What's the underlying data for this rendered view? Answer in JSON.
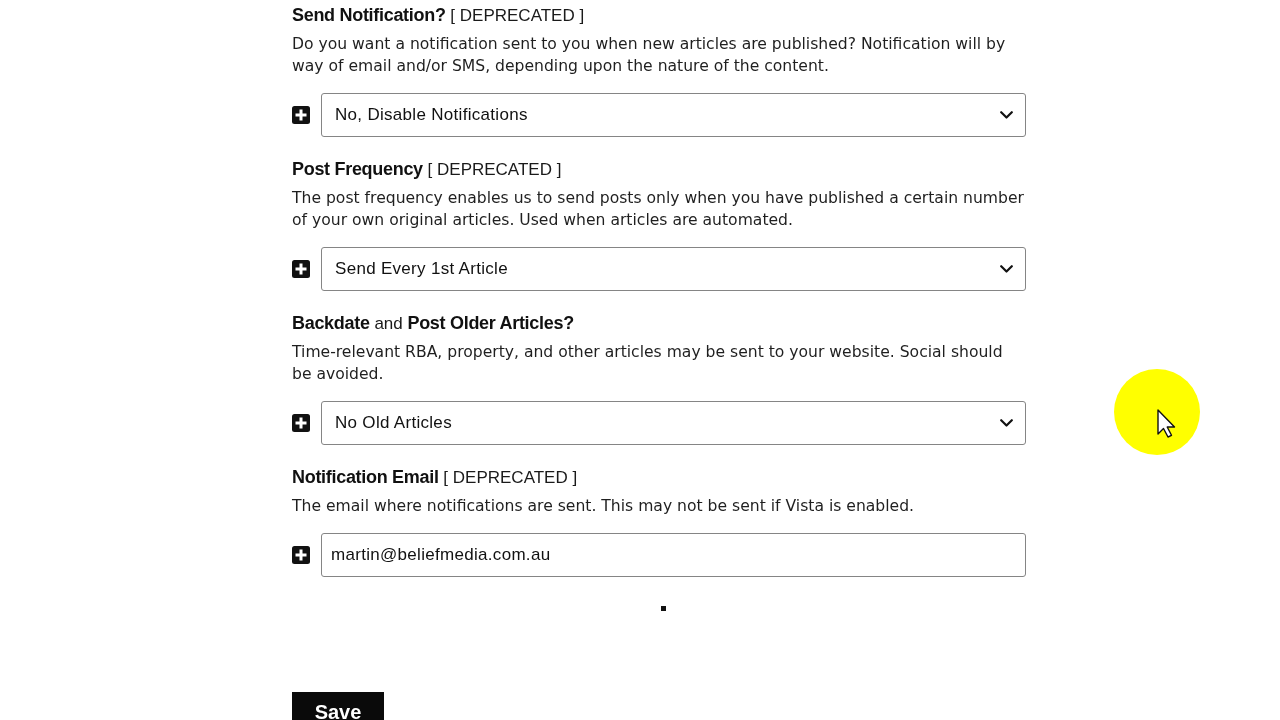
{
  "settings": [
    {
      "kind": "select",
      "heading": "**Send Notification?** [ DEPRECATED ]",
      "description": "Do you want a notification sent to you when new articles are published? Notification will by way of email and/or SMS, depending upon the nature of the content.",
      "value": "No, Disable Notifications"
    },
    {
      "kind": "select",
      "heading": "**Post Frequency** [ DEPRECATED ]",
      "description": "The post frequency enables us to send posts only when you have published a certain number of your own original articles. Used when articles are automated.",
      "value": "Send Every 1st Article"
    },
    {
      "kind": "select",
      "heading": "**Backdate** and **Post Older Articles?**",
      "description": "Time-relevant RBA, property, and other articles may be sent to your website. Social should be avoided.",
      "value": "No Old Articles"
    },
    {
      "kind": "email",
      "heading": "**Notification Email** [ DEPRECATED ]",
      "description": "The email where notifications are sent. This may not be sent if Vista is enabled.",
      "value": "martin@beliefmedia.com.au"
    }
  ],
  "save_button": "Save"
}
